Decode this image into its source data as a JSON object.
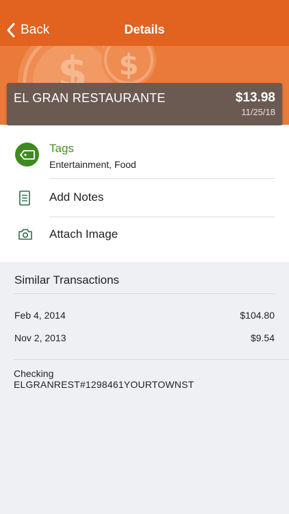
{
  "nav": {
    "back_label": "Back",
    "title": "Details"
  },
  "transaction": {
    "merchant": "EL GRAN RESTAURANTE",
    "amount": "$13.98",
    "date": "11/25/18"
  },
  "actions": {
    "tags_label": "Tags",
    "tags_value": "Entertainment, Food",
    "notes_label": "Add Notes",
    "image_label": "Attach Image"
  },
  "similar": {
    "title": "Similar Transactions",
    "items": [
      {
        "date": "Feb 4, 2014",
        "amount": "$104.80"
      },
      {
        "date": "Nov 2, 2013",
        "amount": "$9.54"
      }
    ]
  },
  "details": {
    "account": "Checking",
    "description": "ELGRANREST#1298461YOURTOWNST"
  },
  "colors": {
    "nav_bg": "#e2621f",
    "hero_bg": "#ea7a3a",
    "merchant_bg": "#6b5a52",
    "tag_green": "#3f8a1e"
  },
  "icons": {
    "back": "chevron-left-icon",
    "tag": "tag-icon",
    "notes": "document-icon",
    "image": "camera-icon",
    "hero": "dollar-coin-icon"
  }
}
